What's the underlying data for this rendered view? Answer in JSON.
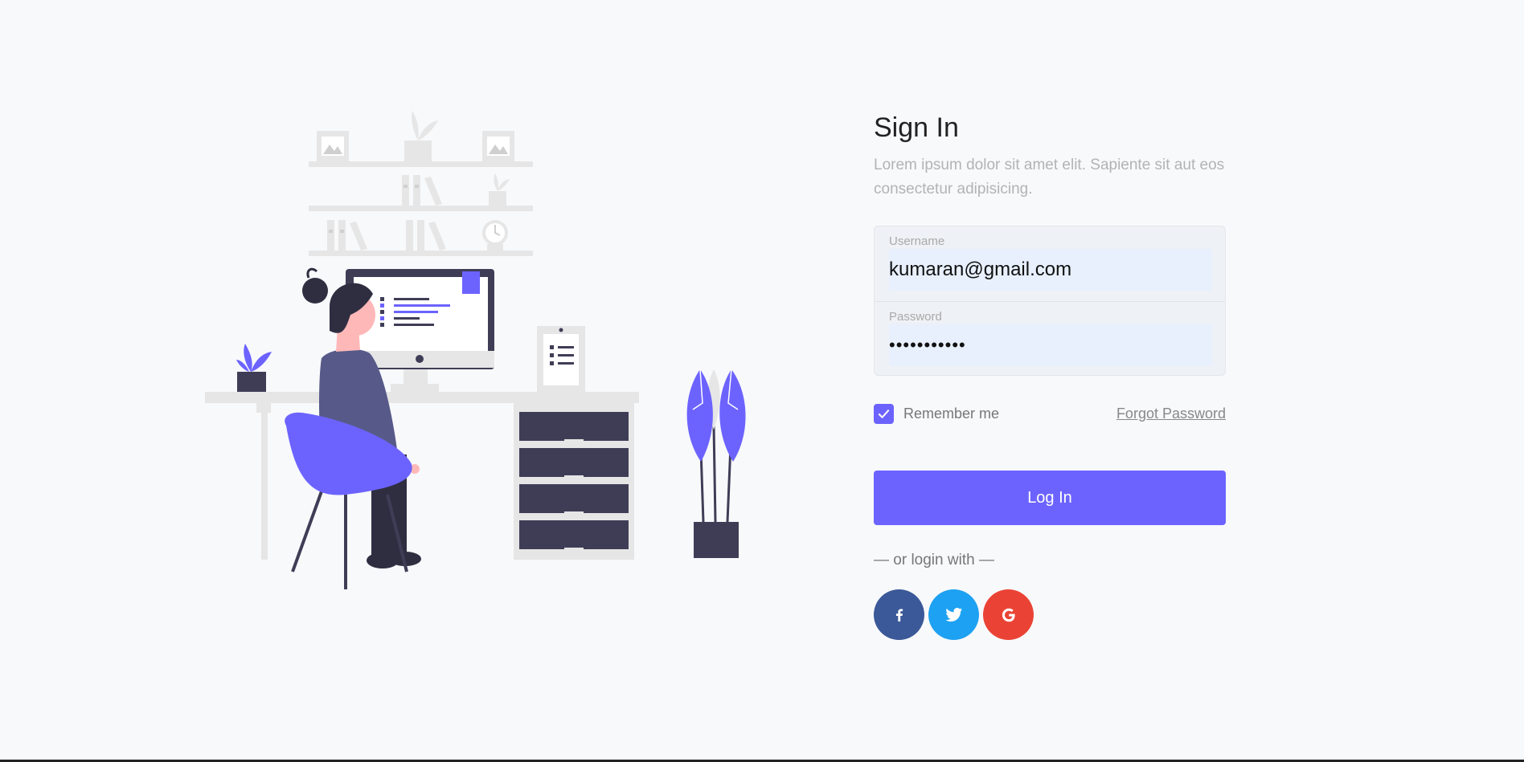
{
  "signin": {
    "title": "Sign In",
    "subtitle": "Lorem ipsum dolor sit amet elit. Sapiente sit aut eos consectetur adipisicing."
  },
  "username": {
    "label": "Username",
    "value": "kumaran@gmail.com"
  },
  "password": {
    "label": "Password",
    "value": "12345678901"
  },
  "options": {
    "remember_label": "Remember me",
    "remember_checked": true,
    "forgot_label": "Forgot Password"
  },
  "login_button": "Log In",
  "social": {
    "divider_text": "— or login with —",
    "buttons": [
      {
        "icon": "facebook-icon",
        "color": "#3b5998"
      },
      {
        "icon": "twitter-icon",
        "color": "#1da1f2"
      },
      {
        "icon": "google-icon",
        "color": "#ea4335"
      }
    ]
  },
  "colors": {
    "accent": "#6c63ff",
    "background": "#f8f9fb"
  }
}
